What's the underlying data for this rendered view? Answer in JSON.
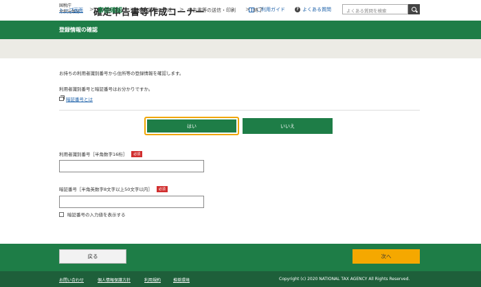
{
  "header": {
    "agency_line1": "国税庁",
    "agency_line2": "令和元年分",
    "site_title": "確定申告書等作成コーナー",
    "guide_link": "ご利用ガイド",
    "faq_link": "よくある質問",
    "search_placeholder": "よくある質問を検索"
  },
  "page": {
    "section_title": "登録情報の確認"
  },
  "breadcrumb": {
    "home": "トップ画面",
    "current": "事前確認",
    "step3": "申告書等の作成",
    "step4": "申告書等の送信・印刷",
    "step5": "終了"
  },
  "main": {
    "intro_text": "お持ちの利用者識別番号から住所等の登録情報を確認します。",
    "question_text": "利用者識別番号と暗証番号はお分かりですか。",
    "pin_help_link": "暗証番号とは",
    "yes_button": "はい",
    "no_button": "いいえ",
    "user_id_label": "利用者識別番号［半角数字16桁］",
    "required_badge": "必須",
    "user_id_value": "",
    "pin_label": "暗証番号［半角英数字8文字以上50文字以内］",
    "pin_value": "",
    "show_pin_label": "暗証番号の入力値を表示する",
    "show_pin_checked": false
  },
  "nav": {
    "back_button": "戻る",
    "next_button": "次へ"
  },
  "footer": {
    "contact": "お問い合わせ",
    "privacy": "個人情報保護方針",
    "terms": "利用規約",
    "env": "推奨環境",
    "copyright": "Copyright (c) 2020 NATIONAL TAX AGENCY All Rights Reserved."
  },
  "colors": {
    "primary_green": "#1e7d47",
    "footer_green": "#1e5f3a",
    "accent_orange": "#f5a800",
    "focus_ring": "#f0a500",
    "required_red": "#d12f2f",
    "link_blue": "#1a5fa8"
  },
  "icons": {
    "guide": "book-icon",
    "faq": "question-circle-icon",
    "search": "search-icon",
    "pin_help": "external-window-icon"
  }
}
